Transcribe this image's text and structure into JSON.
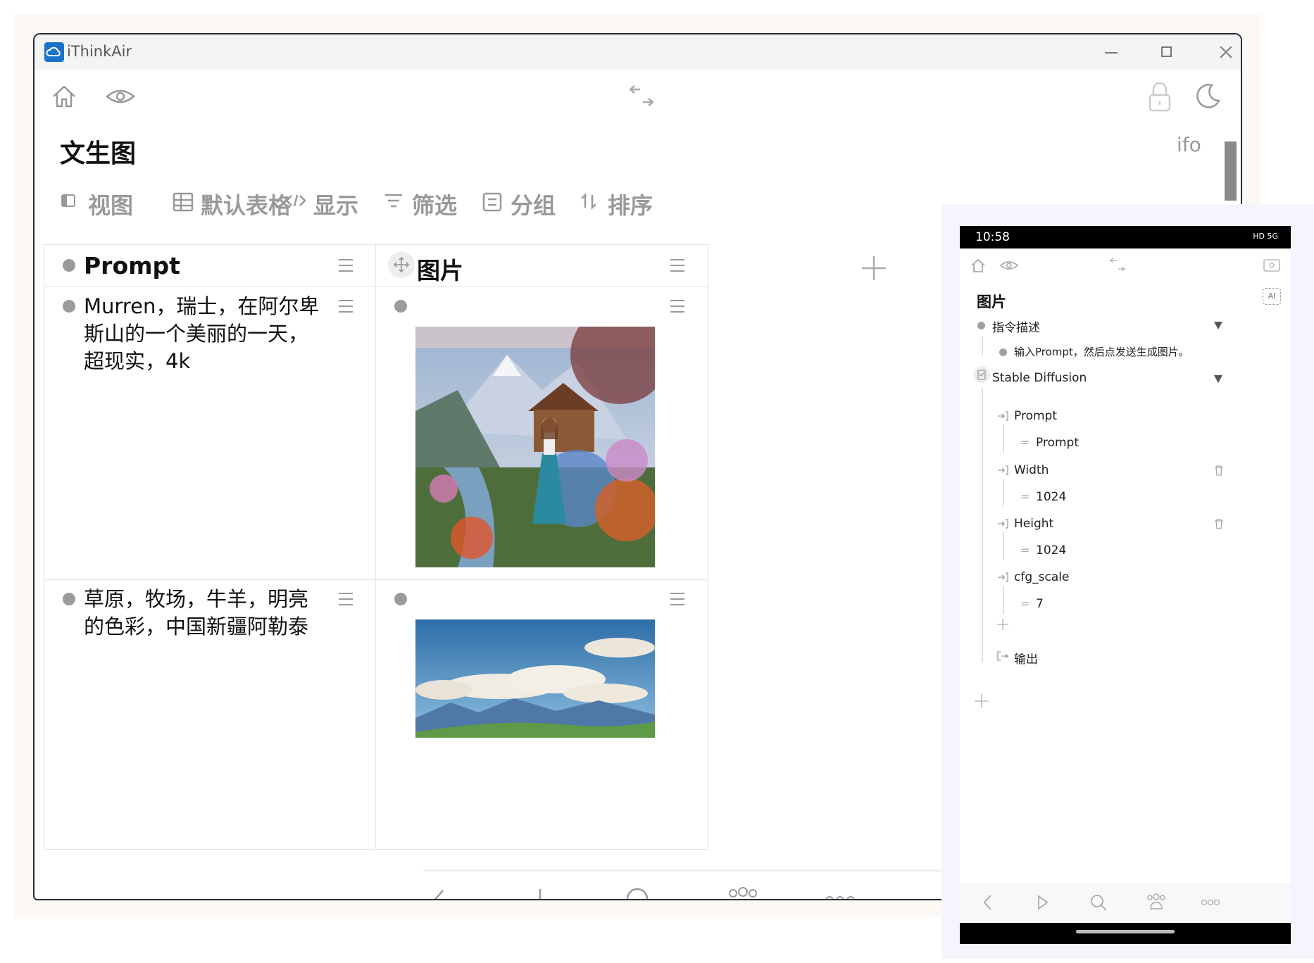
{
  "window": {
    "app_title": "iThinkAir",
    "page_title": "文生图",
    "right_badge": "ifo"
  },
  "toolbar": {
    "view": "视图",
    "table": "默认表格",
    "display": "显示",
    "filter": "筛选",
    "group": "分组",
    "sort": "排序"
  },
  "table": {
    "columns": [
      "Prompt",
      "图片"
    ],
    "rows": [
      {
        "prompt": "Murren，瑞士，在阿尔卑斯山的一个美丽的一天，超现实，4k",
        "image": "painting of a girl in a flower garden with alpine chalet and snowy mountains"
      },
      {
        "prompt": "草原，牧场，牛羊，明亮的色彩，中国新疆阿勒泰",
        "image": "painting of blue sky with clouds over mountains and green meadow"
      }
    ]
  },
  "phone": {
    "time": "10:58",
    "status_icons": "HD 5G",
    "title": "图片",
    "ai_badge": "AI",
    "instruction_label": "指令描述",
    "instruction_text": "输入Prompt，然后点发送生成图片。",
    "node_label": "Stable Diffusion",
    "params": [
      {
        "name": "Prompt",
        "value": "Prompt"
      },
      {
        "name": "Width",
        "value": "1024"
      },
      {
        "name": "Height",
        "value": "1024"
      },
      {
        "name": "cfg_scale",
        "value": "7"
      }
    ],
    "output_label": "输出"
  },
  "colors": {
    "window_border": "#2b2b38",
    "background_panel": "#fcf8f3",
    "icon_gray": "#9b9b9b",
    "logo_blue": "#1a73c9"
  }
}
